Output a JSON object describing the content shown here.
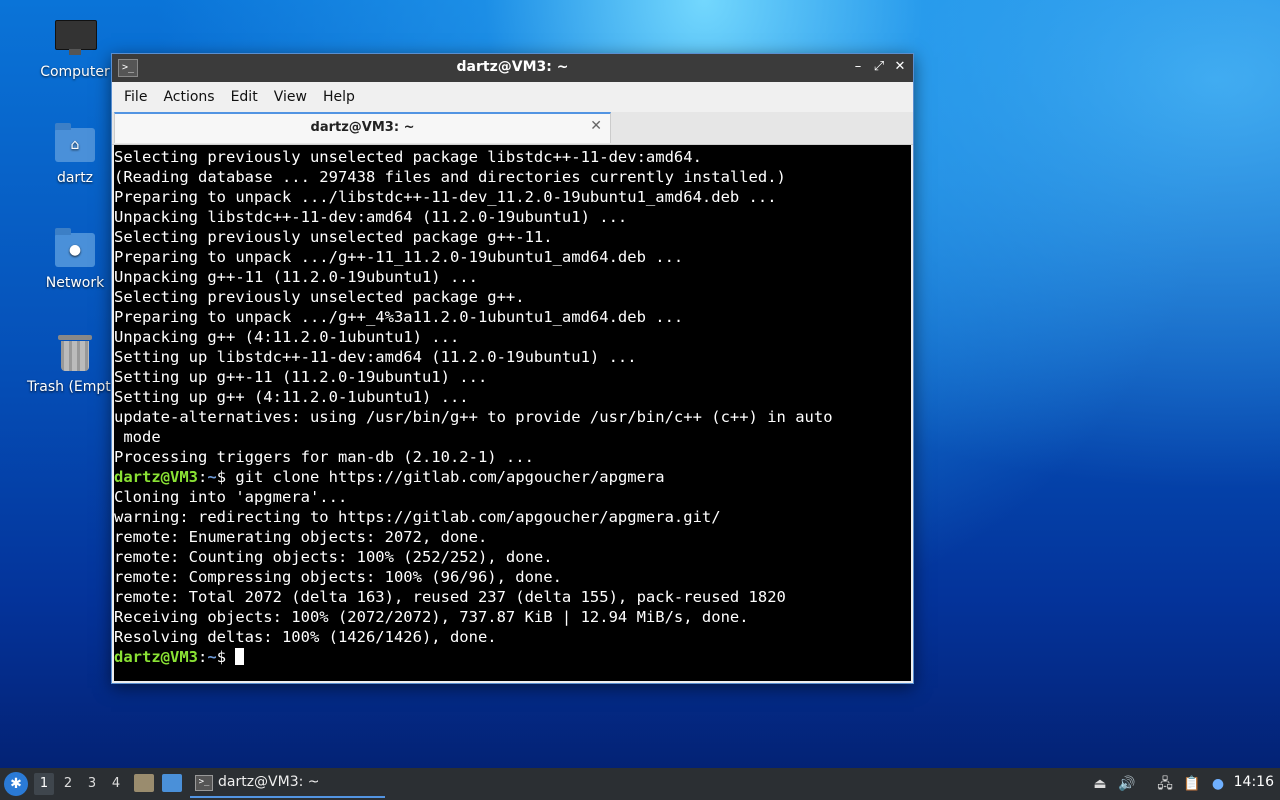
{
  "desktop": {
    "icons": [
      {
        "label": "Computer"
      },
      {
        "label": "dartz"
      },
      {
        "label": "Network"
      },
      {
        "label": "Trash (Empty)"
      }
    ]
  },
  "window": {
    "title": "dartz@VM3: ~",
    "terminal_icon": ">_",
    "controls": {
      "minimize": "–",
      "maximize": "⤢",
      "close": "✕"
    },
    "menu": [
      "File",
      "Actions",
      "Edit",
      "View",
      "Help"
    ],
    "tab": {
      "label": "dartz@VM3: ~",
      "close": "✕"
    }
  },
  "terminal": {
    "colors": {
      "user": "#8ae234",
      "path": "#6f9bd8",
      "text": "#ffffff",
      "background": "#000000"
    },
    "lines": [
      "Selecting previously unselected package libstdc++-11-dev:amd64.",
      "(Reading database ... 297438 files and directories currently installed.)",
      "Preparing to unpack .../libstdc++-11-dev_11.2.0-19ubuntu1_amd64.deb ...",
      "Unpacking libstdc++-11-dev:amd64 (11.2.0-19ubuntu1) ...",
      "Selecting previously unselected package g++-11.",
      "Preparing to unpack .../g++-11_11.2.0-19ubuntu1_amd64.deb ...",
      "Unpacking g++-11 (11.2.0-19ubuntu1) ...",
      "Selecting previously unselected package g++.",
      "Preparing to unpack .../g++_4%3a11.2.0-1ubuntu1_amd64.deb ...",
      "Unpacking g++ (4:11.2.0-1ubuntu1) ...",
      "Setting up libstdc++-11-dev:amd64 (11.2.0-19ubuntu1) ...",
      "Setting up g++-11 (11.2.0-19ubuntu1) ...",
      "Setting up g++ (4:11.2.0-1ubuntu1) ...",
      "update-alternatives: using /usr/bin/g++ to provide /usr/bin/c++ (c++) in auto",
      " mode",
      "Processing triggers for man-db (2.10.2-1) ..."
    ],
    "prompt_user": "dartz@VM3",
    "prompt_sep": ":",
    "prompt_path": "~",
    "prompt_sym": "$ ",
    "command": "git clone https://gitlab.com/apgoucher/apgmera",
    "output": [
      "Cloning into 'apgmera'...",
      "warning: redirecting to https://gitlab.com/apgoucher/apgmera.git/",
      "remote: Enumerating objects: 2072, done.",
      "remote: Counting objects: 100% (252/252), done.",
      "remote: Compressing objects: 100% (96/96), done.",
      "remote: Total 2072 (delta 163), reused 237 (delta 155), pack-reused 1820",
      "Receiving objects: 100% (2072/2072), 737.87 KiB | 12.94 MiB/s, done.",
      "Resolving deltas: 100% (1426/1426), done."
    ]
  },
  "taskbar": {
    "workspaces": [
      "1",
      "2",
      "3",
      "4"
    ],
    "active_workspace": "1",
    "task_label": "dartz@VM3: ~",
    "clock": "14:16"
  }
}
